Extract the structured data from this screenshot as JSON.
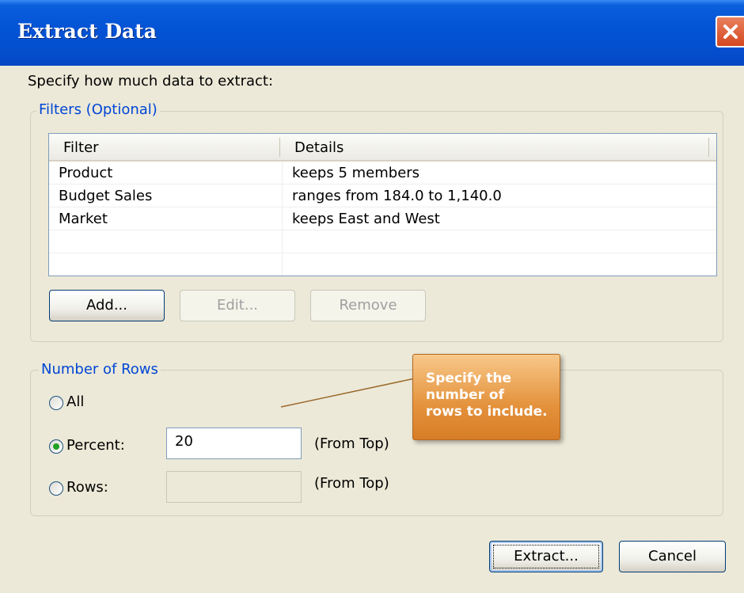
{
  "window": {
    "title": "Extract Data"
  },
  "intro_text": "Specify how much data to extract:",
  "filters": {
    "group_label": "Filters (Optional)",
    "columns": [
      "Filter",
      "Details"
    ],
    "rows": [
      {
        "filter": "Product",
        "details": "keeps 5 members"
      },
      {
        "filter": "Budget Sales",
        "details": "ranges from 184.0 to 1,140.0"
      },
      {
        "filter": "Market",
        "details": "keeps East and West"
      }
    ],
    "add_label": "Add...",
    "edit_label": "Edit...",
    "remove_label": "Remove"
  },
  "rows_group": {
    "group_label": "Number of Rows",
    "all_label": "All",
    "percent_label": "Percent:",
    "percent_value": "20",
    "percent_suffix": "(From Top)",
    "rows_label": "Rows:",
    "rows_value": "",
    "rows_suffix": "(From Top)",
    "selected": "Percent"
  },
  "callout": {
    "line1": "Specify the",
    "line2": "number of",
    "line3": "rows to include."
  },
  "footer": {
    "extract_label": "Extract...",
    "cancel_label": "Cancel"
  },
  "colors": {
    "titlebar": "#0454D6",
    "group_title": "#0046D5",
    "callout": "#E4923C",
    "radio_dot": "#21A121"
  },
  "icons": {
    "close": "close-icon"
  }
}
